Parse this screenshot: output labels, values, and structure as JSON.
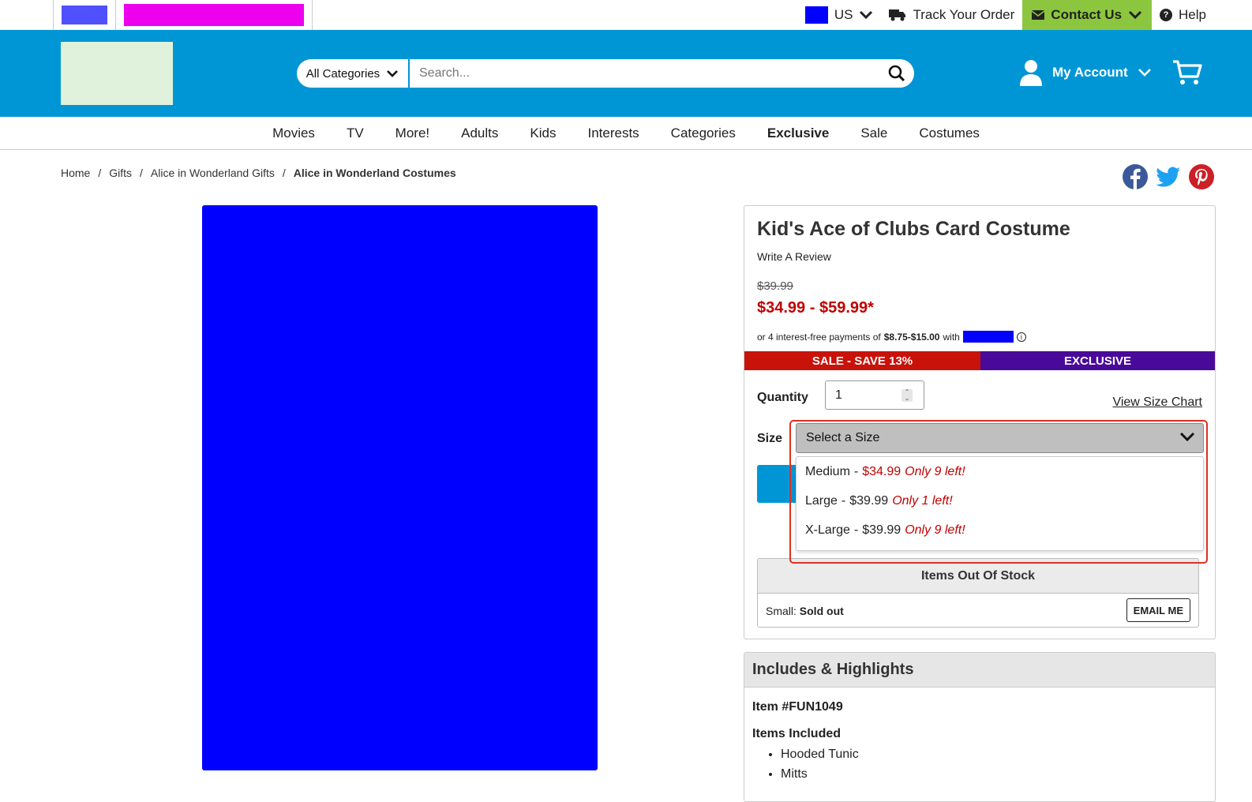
{
  "topbar": {
    "country": "US",
    "track_order": "Track Your Order",
    "contact_us": "Contact Us",
    "help": "Help"
  },
  "header": {
    "category_label": "All Categories",
    "search_placeholder": "Search...",
    "account_label": "My Account"
  },
  "nav": {
    "items": [
      "Movies",
      "TV",
      "More!",
      "Adults",
      "Kids",
      "Interests",
      "Categories",
      "Exclusive",
      "Sale",
      "Costumes"
    ]
  },
  "breadcrumb": {
    "items": [
      "Home",
      "Gifts",
      "Alice in Wonderland Gifts",
      "Alice in Wonderland Costumes"
    ],
    "separator": "/"
  },
  "product": {
    "title": "Kid's Ace of Clubs Card Costume",
    "write_review": "Write A Review",
    "old_price": "$39.99",
    "price_range": "$34.99 - $59.99*",
    "payments_prefix": "or 4 interest-free payments of",
    "payments_amount": "$8.75-$15.00",
    "payments_with": "with",
    "badge_sale": "SALE - SAVE 13%",
    "badge_exclusive": "EXCLUSIVE",
    "quantity_label": "Quantity",
    "quantity_value": "1",
    "size_chart": "View Size Chart",
    "size_label": "Size",
    "size_select": "Select a Size",
    "size_options": [
      {
        "size": "Medium",
        "sep": "-",
        "price": "$34.99",
        "stock": "Only 9 left!"
      },
      {
        "size": "Large",
        "sep": "-",
        "price": "$39.99",
        "stock": "Only 1 left!"
      },
      {
        "size": "X-Large",
        "sep": "-",
        "price": "$39.99",
        "stock": "Only 9 left!"
      }
    ],
    "out_of_stock_title": "Items Out Of Stock",
    "oos_size": "Small:",
    "oos_status": "Sold out",
    "email_me": "EMAIL ME"
  },
  "includes": {
    "title": "Includes & Highlights",
    "item_number": "Item #FUN1049",
    "items_included_label": "Items Included",
    "items": [
      "Hooded Tunic",
      "Mitts"
    ]
  },
  "colors": {
    "brand_blue": "#0096d6",
    "contact_green": "#8cc63f",
    "sale_red": "#c8120a",
    "exclusive_purple": "#4a0a99",
    "price_red": "#c00000"
  }
}
